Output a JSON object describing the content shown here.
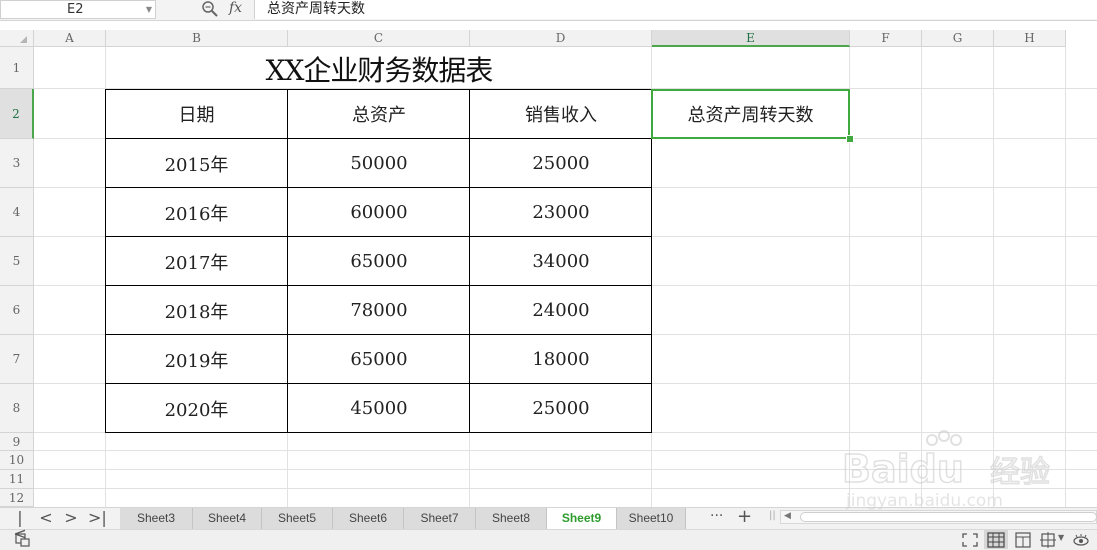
{
  "formula_bar": {
    "name_box": "E2",
    "fx_label": "fx",
    "formula": "总资产周转天数",
    "zoom_icon": "zoom-icon"
  },
  "columns": [
    "A",
    "B",
    "C",
    "D",
    "E",
    "F",
    "G",
    "H"
  ],
  "selected_column": "E",
  "rows": [
    "1",
    "2",
    "3",
    "4",
    "5",
    "6",
    "7",
    "8",
    "9",
    "10",
    "11",
    "12"
  ],
  "selected_row": "2",
  "sheet": {
    "title": "XX企业财务数据表",
    "headers": [
      "日期",
      "总资产",
      "销售收入"
    ],
    "active_cell_value": "总资产周转天数",
    "data": [
      [
        "2015年",
        "50000",
        "25000"
      ],
      [
        "2016年",
        "60000",
        "23000"
      ],
      [
        "2017年",
        "65000",
        "34000"
      ],
      [
        "2018年",
        "78000",
        "24000"
      ],
      [
        "2019年",
        "65000",
        "18000"
      ],
      [
        "2020年",
        "45000",
        "25000"
      ]
    ]
  },
  "tabs": {
    "nav": [
      "|<",
      "<",
      ">",
      ">|"
    ],
    "sheets": [
      "Sheet3",
      "Sheet4",
      "Sheet5",
      "Sheet6",
      "Sheet7",
      "Sheet8",
      "Sheet9",
      "Sheet10"
    ],
    "active": "Sheet9",
    "more": "···",
    "add": "+"
  },
  "colors": {
    "accent_green": "#3fa93f",
    "active_tab_text": "#2e9d2e"
  }
}
